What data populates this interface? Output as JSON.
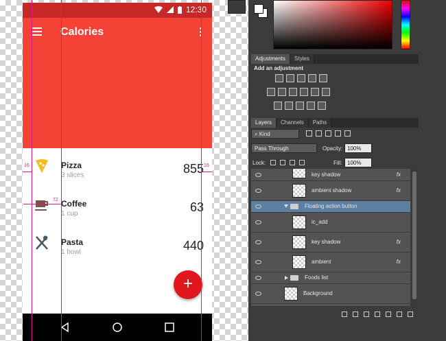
{
  "phone": {
    "status_time": "12:30",
    "title": "Calories",
    "items": [
      {
        "name": "Pizza",
        "sub": "3 slices",
        "value": "855",
        "icon": "pizza-icon",
        "icon_color": "#f9b826"
      },
      {
        "name": "Coffee",
        "sub": "1 cup",
        "value": "63",
        "icon": "coffee-icon",
        "icon_color": "#795548"
      },
      {
        "name": "Pasta",
        "sub": "1 bowl",
        "value": "440",
        "icon": "utensils-icon",
        "icon_color": "#455a64"
      }
    ],
    "fab_label": "+",
    "colors": {
      "primary": "#f44336",
      "primary_dark": "#c62828",
      "accent": "#e0171f"
    }
  },
  "guides": {
    "left_margin": "16",
    "right_margin": "16",
    "text_keyline": "72"
  },
  "photoshop": {
    "adjust_tabs": [
      {
        "label": "Adjustments",
        "active": true
      },
      {
        "label": "Styles",
        "active": false
      }
    ],
    "add_adjustment": "Add an adjustment",
    "layer_tabs": [
      {
        "label": "Layers",
        "active": true
      },
      {
        "label": "Channels",
        "active": false
      },
      {
        "label": "Paths",
        "active": false
      }
    ],
    "kind_label": "Kind",
    "blend_mode": "Pass Through",
    "opacity_label": "Opacity:",
    "opacity_value": "100%",
    "lock_label": "Lock:",
    "fill_label": "Fill:",
    "fill_value": "100%",
    "layers": [
      {
        "name": "key shadow",
        "fx": "fx",
        "kind": "layer",
        "indent": 2
      },
      {
        "name": "ambient shadow",
        "fx": "fx",
        "kind": "layer",
        "indent": 2
      },
      {
        "name": "Floating action button",
        "fx": "",
        "kind": "group-open",
        "indent": 1,
        "selected": true
      },
      {
        "name": "ic_add",
        "fx": "",
        "kind": "layer",
        "indent": 2
      },
      {
        "name": "key shadow",
        "fx": "fx",
        "kind": "layer",
        "indent": 2
      },
      {
        "name": "ambient",
        "fx": "fx",
        "kind": "layer",
        "indent": 2
      },
      {
        "name": "Foods list",
        "fx": "",
        "kind": "group-closed",
        "indent": 1
      },
      {
        "name": "Background",
        "fx": "",
        "kind": "layer",
        "indent": 1
      }
    ]
  }
}
